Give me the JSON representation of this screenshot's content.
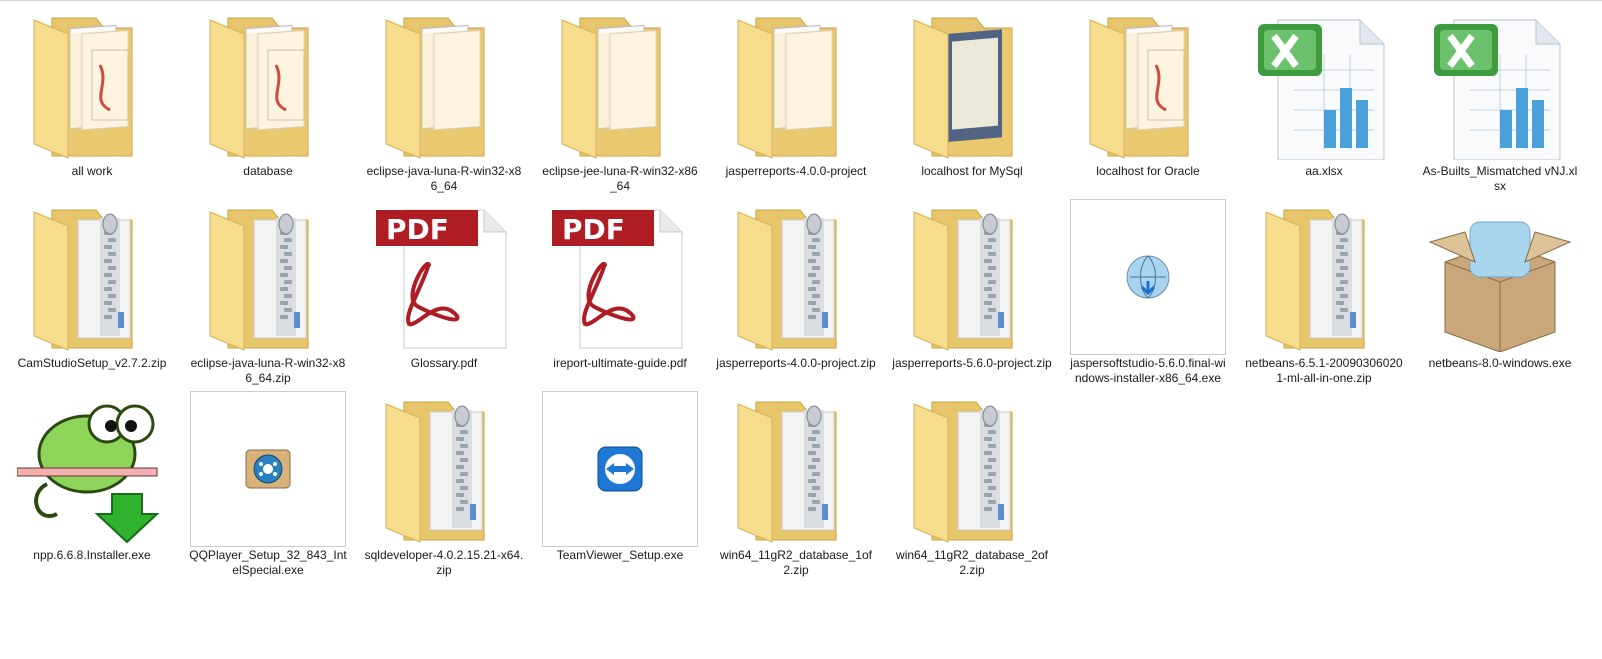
{
  "items": [
    {
      "label": "all work",
      "icon": "folder-documents-icon"
    },
    {
      "label": "database",
      "icon": "folder-documents-icon"
    },
    {
      "label": "eclipse-java-luna-R-win32-x86_64",
      "icon": "folder-icon"
    },
    {
      "label": "eclipse-jee-luna-R-win32-x86_64",
      "icon": "folder-icon"
    },
    {
      "label": "jasperreports-4.0.0-project",
      "icon": "folder-icon"
    },
    {
      "label": "localhost for MySql",
      "icon": "folder-screenshots-icon"
    },
    {
      "label": "localhost for Oracle",
      "icon": "folder-documents-icon"
    },
    {
      "label": "aa.xlsx",
      "icon": "excel-file-icon"
    },
    {
      "label": "As-Builts_Mismatched vNJ.xlsx",
      "icon": "excel-file-icon"
    },
    {
      "label": "CamStudioSetup_v2.7.2.zip",
      "icon": "zip-folder-icon"
    },
    {
      "label": "eclipse-java-luna-R-win32-x86_64.zip",
      "icon": "zip-folder-icon"
    },
    {
      "label": "Glossary.pdf",
      "icon": "pdf-file-icon"
    },
    {
      "label": "ireport-ultimate-guide.pdf",
      "icon": "pdf-file-icon"
    },
    {
      "label": "jasperreports-4.0.0-project.zip",
      "icon": "zip-folder-icon"
    },
    {
      "label": "jasperreports-5.6.0-project.zip",
      "icon": "zip-folder-icon"
    },
    {
      "label": "jaspersoftstudio-5.6.0.final-windows-installer-x86_64.exe",
      "icon": "installer-globe-icon"
    },
    {
      "label": "netbeans-6.5.1-200903060201-ml-all-in-one.zip",
      "icon": "zip-folder-icon"
    },
    {
      "label": "netbeans-8.0-windows.exe",
      "icon": "package-box-icon"
    },
    {
      "label": "npp.6.6.8.Installer.exe",
      "icon": "notepad-plus-plus-chameleon-icon"
    },
    {
      "label": "QQPlayer_Setup_32_843_IntelSpecial.exe",
      "icon": "qqplayer-icon"
    },
    {
      "label": "sqldeveloper-4.0.2.15.21-x64.zip",
      "icon": "zip-folder-icon"
    },
    {
      "label": "TeamViewer_Setup.exe",
      "icon": "teamviewer-icon"
    },
    {
      "label": "win64_11gR2_database_1of2.zip",
      "icon": "zip-folder-icon"
    },
    {
      "label": "win64_11gR2_database_2of2.zip",
      "icon": "zip-folder-icon"
    }
  ],
  "pdf_badge": "PDF"
}
